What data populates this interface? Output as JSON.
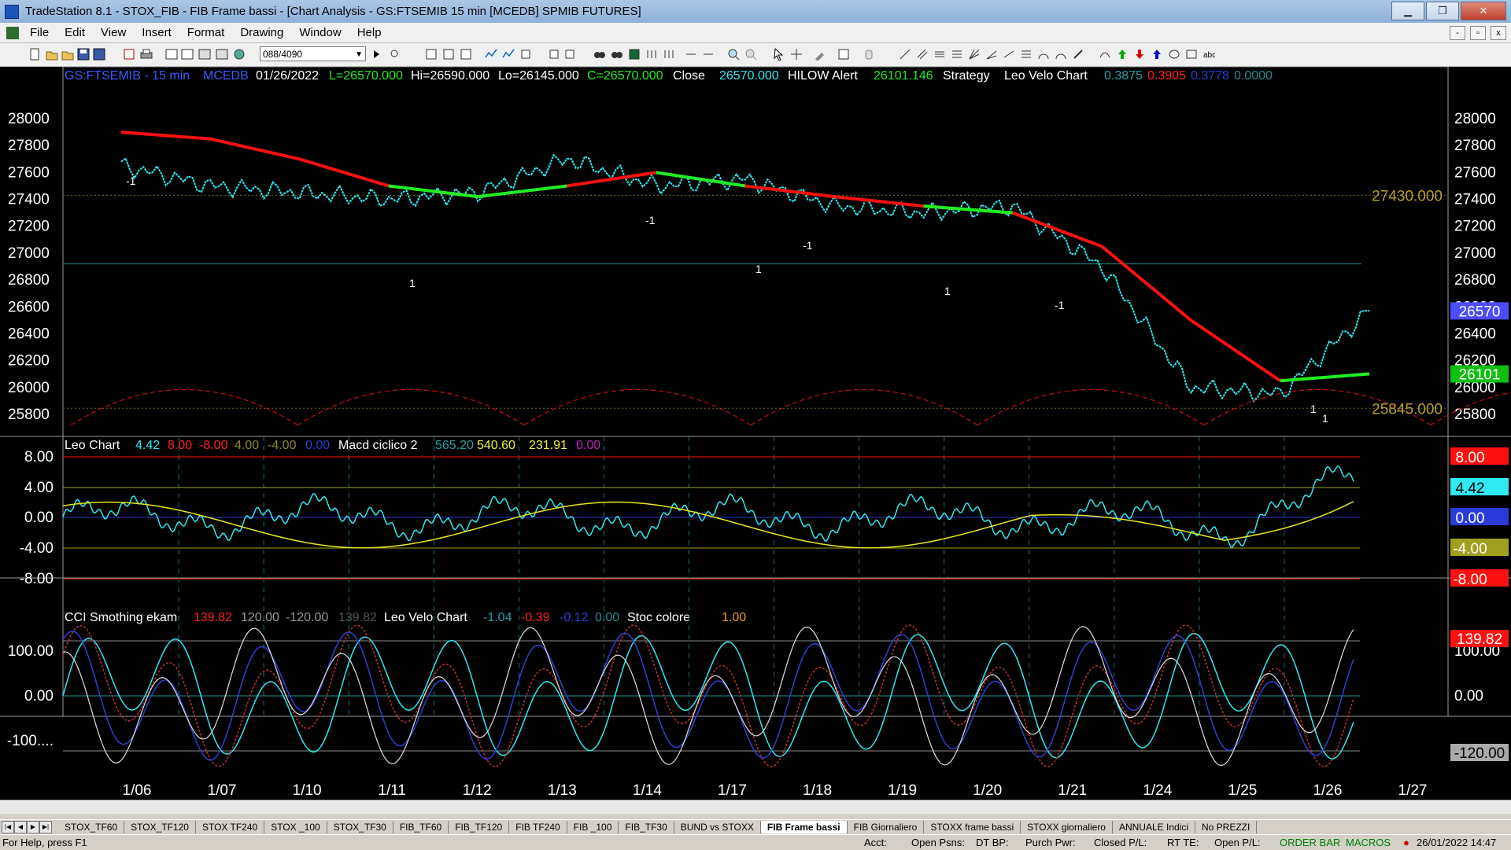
{
  "window": {
    "title": "TradeStation 8.1 - STOX_FIB - FIB Frame bassi - [Chart Analysis - GS:FTSEMIB  15 min  [MCEDB] SPMIB FUTURES]",
    "min_label": "▁",
    "max_label": "❐",
    "close_label": "✕"
  },
  "menu": [
    "File",
    "Edit",
    "View",
    "Insert",
    "Format",
    "Drawing",
    "Window",
    "Help"
  ],
  "toolbar": {
    "bars_combo": "088/4090"
  },
  "mdi": {
    "min": "-",
    "restore": "▫",
    "close": "x"
  },
  "header": {
    "symbol": "GS:FTSEMIB - 15 min",
    "feed": "MCEDB",
    "date": "01/26/2022",
    "last": "L=26570.000",
    "high": "Hi=26590.000",
    "low": "Lo=26145.000",
    "close": "C=26570.000",
    "close_label": "Close",
    "close_value": "26570.000",
    "hilow_label": "HILOW Alert",
    "hilow_value": "26101.146",
    "strategy_label": "Strategy",
    "leo_velo_label": "Leo Velo Chart",
    "leo_v1": "0.3875",
    "leo_v2": "0.3905",
    "leo_v3": "0.3778",
    "leo_v4": "0.0000"
  },
  "panel2": {
    "name": "Leo Chart",
    "v1": "4.42",
    "v2": "8.00",
    "v3": "-8.00",
    "v4": "4.00",
    "v5": "-4.00",
    "v6": "0.00",
    "macd_label": "Macd ciclico 2",
    "m1": "565.20",
    "m2": "540.60",
    "m3": "231.91",
    "m4": "0.00"
  },
  "panel3": {
    "cci_label": "CCI Smothing ekam",
    "c1": "139.82",
    "c2": "120.00",
    "c3": "-120.00",
    "c4": "139.82",
    "leo_velo_label": "Leo Velo Chart",
    "l1": "-1.04",
    "l2": "-0.39",
    "l3": "-0.12",
    "l4": "0.00",
    "stoc_label": "Stoc colore",
    "s1": "1.00"
  },
  "axis": {
    "price_ticks": [
      "28000",
      "27800",
      "27600",
      "27400",
      "27200",
      "27000",
      "26800",
      "26600",
      "26400",
      "26200",
      "26000",
      "25800"
    ],
    "leo_ticks": [
      "8.00",
      "4.00",
      "0.00",
      "-4.00",
      "-8.00"
    ],
    "cci_ticks": [
      "100.00",
      "0.00",
      "-100...."
    ],
    "cci_ticks_right": [
      "100.00",
      "0.00"
    ],
    "dates": [
      "1/06",
      "1/07",
      "1/10",
      "1/11",
      "1/12",
      "1/13",
      "1/14",
      "1/17",
      "1/18",
      "1/19",
      "1/20",
      "1/21",
      "1/24",
      "1/25",
      "1/26",
      "1/27"
    ]
  },
  "price_labels": {
    "last": "26570",
    "hilow": "26101",
    "high_line": "27430.000",
    "low_line": "25845.000"
  },
  "panel2_labels": [
    "8.00",
    "4.42",
    "0.00",
    "-4.00",
    "-8.00"
  ],
  "panel3_labels": [
    "139.82",
    "-120.00"
  ],
  "signals": [
    "-1",
    "-1",
    "-1",
    "-1",
    "1",
    "1",
    "1",
    "1",
    "1"
  ],
  "tabs": [
    "STOX_TF60",
    "STOX_TF120",
    "STOX TF240",
    "STOX _100",
    "STOX_TF30",
    "FIB_TF60",
    "FIB_TF120",
    "FIB TF240",
    "FIB _100",
    "FIB_TF30",
    "BUND vs STOXX",
    "FIB Frame bassi",
    "FIB Giornaliero",
    "STOXX frame bassi",
    "STOXX giornaliero",
    "ANNUALE Indici",
    "No PREZZI"
  ],
  "status": {
    "help": "For Help, press F1",
    "acct": "Acct:",
    "open_psns": "Open Psns:",
    "dt_bp": "DT BP:",
    "purch_pwr": "Purch Pwr:",
    "closed_pl": "Closed P/L:",
    "rt_te": "RT TE:",
    "open_pl": "Open P/L:",
    "order_bar": "ORDER BAR",
    "macros": "MACROS",
    "datetime": "26/01/2022 14:47"
  },
  "colors": {
    "price": "#2fe8f0",
    "ma_down": "#ff1010",
    "ma_up": "#22ee22",
    "axis_text": "#ffffff",
    "accent_line": "#8a8a2a"
  },
  "chart_data": {
    "type": "line",
    "title": "GS:FTSEMIB - 15 min",
    "categories": [
      "1/06",
      "1/07",
      "1/10",
      "1/11",
      "1/12",
      "1/13",
      "1/14",
      "1/17",
      "1/18",
      "1/19",
      "1/20",
      "1/21",
      "1/24",
      "1/25",
      "1/26"
    ],
    "series": [
      {
        "name": "Close",
        "values": [
          27650,
          27500,
          27450,
          27400,
          27450,
          27700,
          27500,
          27550,
          27350,
          27300,
          27350,
          26900,
          26000,
          25950,
          26570
        ]
      },
      {
        "name": "HILOW Alert",
        "values": [
          27900,
          27850,
          27700,
          27500,
          27420,
          27500,
          27600,
          27500,
          27420,
          27350,
          27300,
          27050,
          26500,
          26050,
          26101
        ]
      }
    ],
    "ylim": [
      25700,
      28100
    ],
    "ylabel": "",
    "xlabel": "",
    "reference_lines": [
      27430,
      25845
    ],
    "grid": false
  }
}
